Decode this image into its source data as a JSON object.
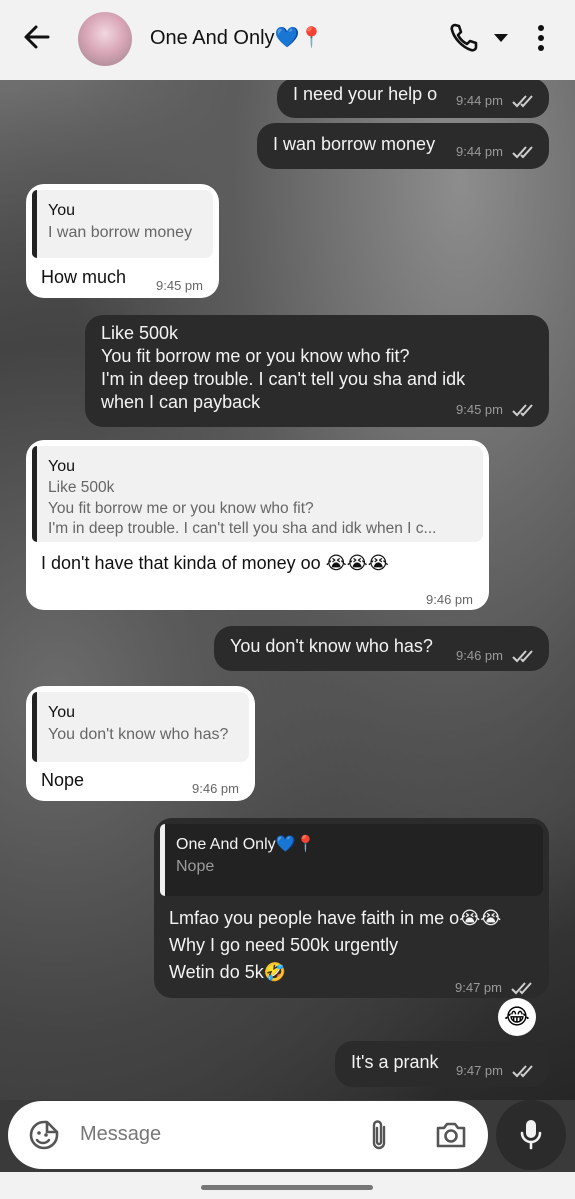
{
  "header": {
    "contact_name": "One And Only💙📍",
    "back_icon": "arrow-left-icon",
    "call_icon": "phone-icon",
    "menu_icon": "more-vert-icon"
  },
  "messages": [
    {
      "id": "m1",
      "direction": "out",
      "text": "I need your help o",
      "time": "9:44 pm"
    },
    {
      "id": "m2",
      "direction": "out",
      "text": "I wan borrow money",
      "time": "9:44 pm"
    },
    {
      "id": "m3",
      "direction": "in",
      "quote_name": "You",
      "quote_text": "I wan borrow money",
      "text": "How much",
      "time": "9:45 pm"
    },
    {
      "id": "m4",
      "direction": "out",
      "text": "Like 500k\nYou fit borrow me or you know who fit?\nI'm in deep trouble. I can't tell you sha and idk\nwhen I can payback",
      "time": "9:45 pm"
    },
    {
      "id": "m5",
      "direction": "in",
      "quote_name": "You",
      "quote_text": "Like 500k\nYou fit borrow me or you know who fit?\nI'm in deep trouble. I can't tell you sha and idk when I c...",
      "text": "I don't have that kinda of money oo 😭😭😭",
      "time": "9:46 pm"
    },
    {
      "id": "m6",
      "direction": "out",
      "text": "You don't know who has?",
      "time": "9:46 pm"
    },
    {
      "id": "m7",
      "direction": "in",
      "quote_name": "You",
      "quote_text": "You don't know who has?",
      "text": "Nope",
      "time": "9:46 pm"
    },
    {
      "id": "m8",
      "direction": "out",
      "quote_name": "One And Only💙📍",
      "quote_text": "Nope",
      "text": "Lmfao you people have faith in me o😭😭\nWhy I go need 500k urgently\nWetin do 5k🤣",
      "time": "9:47 pm",
      "reaction": "😂"
    },
    {
      "id": "m9",
      "direction": "out",
      "text": "It's a prank",
      "time": "9:47 pm"
    }
  ],
  "composer": {
    "placeholder": "Message",
    "sticker_icon": "sticker-icon",
    "attach_icon": "paperclip-icon",
    "camera_icon": "camera-icon",
    "mic_icon": "mic-icon"
  },
  "colors": {
    "outgoing_bubble": "#2b2b2b",
    "incoming_bubble": "#ffffff",
    "header_bg": "#f2f2f2"
  }
}
